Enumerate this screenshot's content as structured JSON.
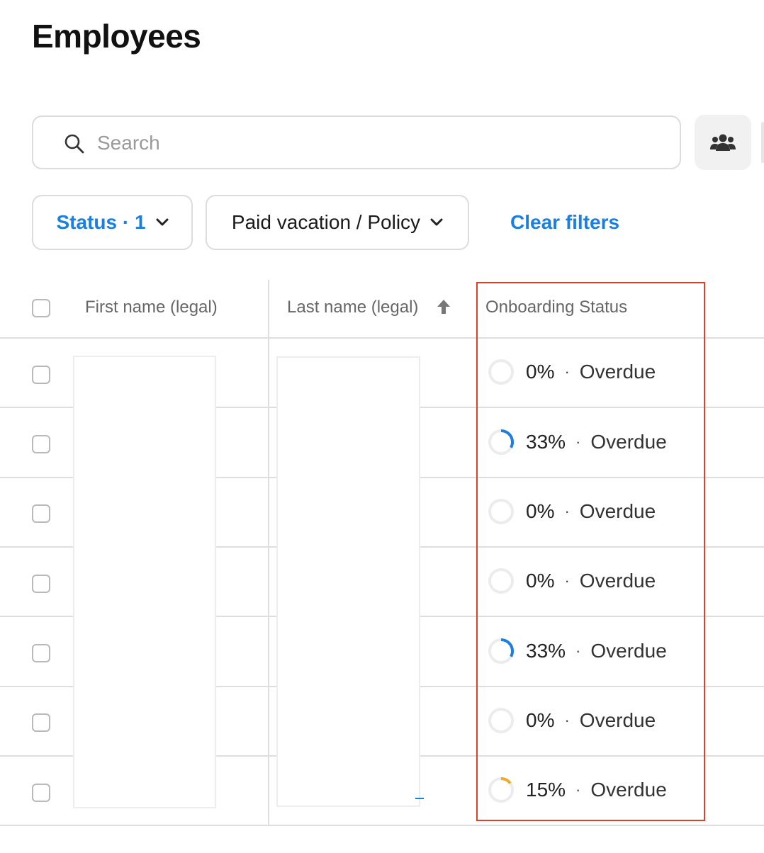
{
  "page": {
    "title": "Employees"
  },
  "search": {
    "placeholder": "Search",
    "value": ""
  },
  "toolbar": {
    "group_icon": "people-group-icon"
  },
  "filters": [
    {
      "label": "Status · 1",
      "active": true
    },
    {
      "label": "Paid vacation / Policy",
      "active": false
    }
  ],
  "clear_filters_label": "Clear filters",
  "table": {
    "columns": [
      "First name (legal)",
      "Last name (legal)",
      "Onboarding Status"
    ],
    "sorted_column": "Last name (legal)",
    "sort_direction": "ascending",
    "rows": [
      {
        "progress": "0%",
        "progress_value": 0,
        "state": "Overdue",
        "ring_color": ""
      },
      {
        "progress": "33%",
        "progress_value": 0.33,
        "state": "Overdue",
        "ring_color": "#1a7fe0"
      },
      {
        "progress": "0%",
        "progress_value": 0,
        "state": "Overdue",
        "ring_color": ""
      },
      {
        "progress": "0%",
        "progress_value": 0,
        "state": "Overdue",
        "ring_color": ""
      },
      {
        "progress": "33%",
        "progress_value": 0.33,
        "state": "Overdue",
        "ring_color": "#1a7fe0"
      },
      {
        "progress": "0%",
        "progress_value": 0,
        "state": "Overdue",
        "ring_color": ""
      },
      {
        "progress": "15%",
        "progress_value": 0.15,
        "state": "Overdue",
        "ring_color": "#f0a92b"
      }
    ]
  },
  "colors": {
    "accent": "#1a7fe0",
    "highlight_outline": "#d9432a",
    "ring_track": "#ececec"
  }
}
